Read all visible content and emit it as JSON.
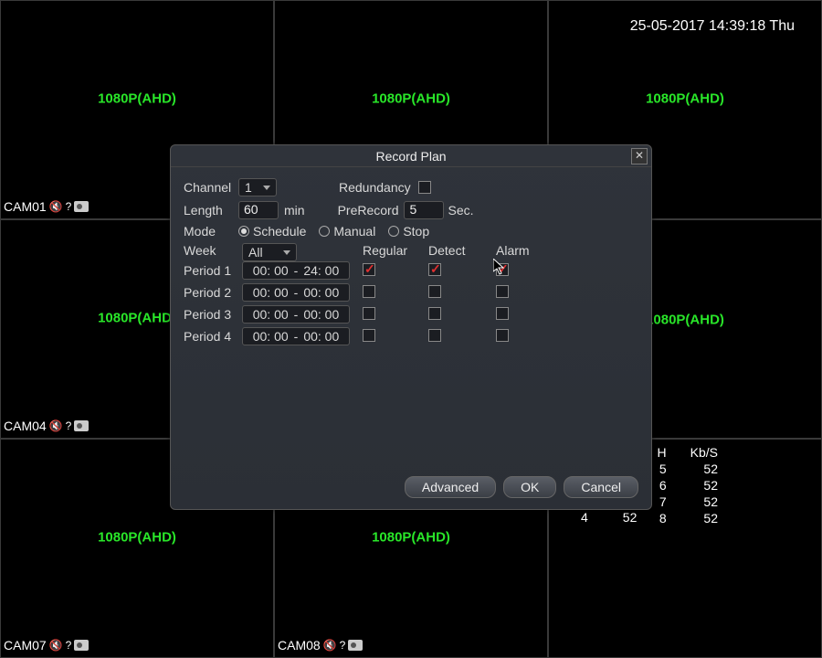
{
  "timestamp": "25-05-2017 14:39:18 Thu",
  "cells": {
    "resolution": "1080P(AHD)",
    "cams": [
      "CAM01",
      "CAM04",
      "CAM07",
      "CAM08"
    ]
  },
  "dialog": {
    "title": "Record Plan",
    "channel_label": "Channel",
    "channel_value": "1",
    "redundancy_label": "Redundancy",
    "redundancy_checked": false,
    "length_label": "Length",
    "length_value": "60",
    "length_unit": "min",
    "prerecord_label": "PreRecord",
    "prerecord_value": "5",
    "prerecord_unit": "Sec.",
    "mode_label": "Mode",
    "mode_options": {
      "schedule": "Schedule",
      "manual": "Manual",
      "stop": "Stop"
    },
    "mode_selected": "schedule",
    "week_label": "Week",
    "week_value": "All",
    "col_regular": "Regular",
    "col_detect": "Detect",
    "col_alarm": "Alarm",
    "periods": [
      {
        "label": "Period 1",
        "from": "00: 00",
        "to": "24: 00",
        "regular": true,
        "detect": true,
        "alarm": true
      },
      {
        "label": "Period 2",
        "from": "00: 00",
        "to": "00: 00",
        "regular": false,
        "detect": false,
        "alarm": false
      },
      {
        "label": "Period 3",
        "from": "00: 00",
        "to": "00: 00",
        "regular": false,
        "detect": false,
        "alarm": false
      },
      {
        "label": "Period 4",
        "from": "00: 00",
        "to": "00: 00",
        "regular": false,
        "detect": false,
        "alarm": false
      }
    ],
    "buttons": {
      "advanced": "Advanced",
      "ok": "OK",
      "cancel": "Cancel"
    }
  },
  "stats": {
    "head_h": "H",
    "head_kbs": "Kb/S",
    "rows": [
      {
        "h": "5",
        "kbs": "52"
      },
      {
        "h": "6",
        "kbs": "52"
      },
      {
        "h": "7",
        "kbs": "52"
      },
      {
        "h": "8",
        "kbs": "52"
      }
    ],
    "extra": {
      "a": "4",
      "b": "52"
    }
  }
}
